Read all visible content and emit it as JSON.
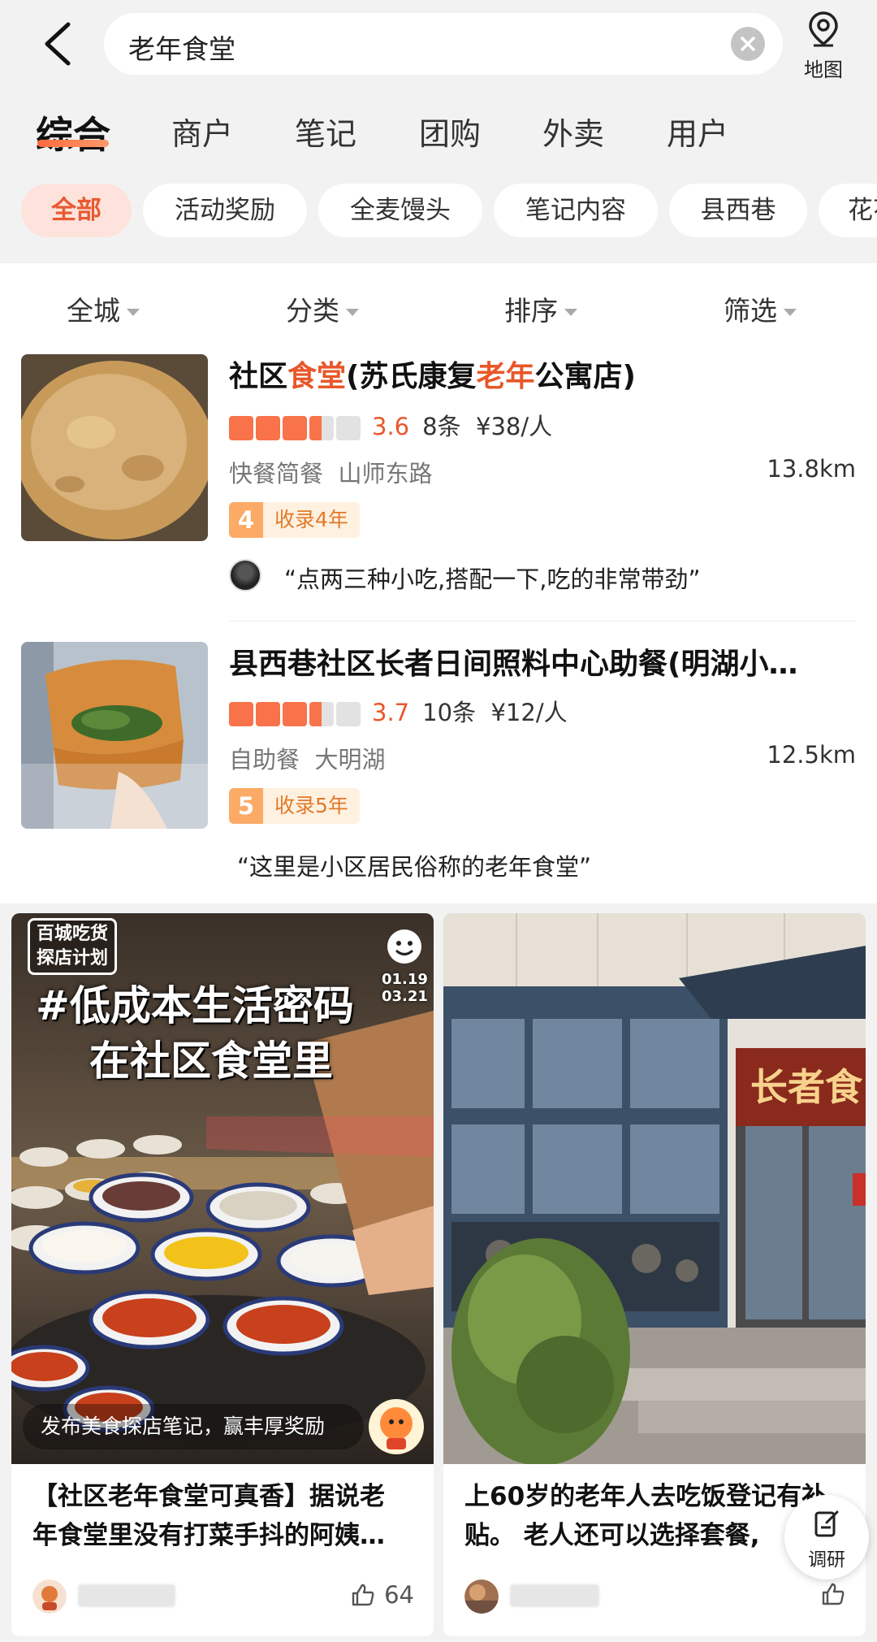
{
  "search": {
    "query": "老年食堂",
    "map_label": "地图"
  },
  "tabs": [
    {
      "label": "综合",
      "active": true
    },
    {
      "label": "商户"
    },
    {
      "label": "笔记"
    },
    {
      "label": "团购"
    },
    {
      "label": "外卖"
    },
    {
      "label": "用户"
    }
  ],
  "chips": [
    "全部",
    "活动奖励",
    "全麦馒头",
    "笔记内容",
    "县西巷",
    "花花"
  ],
  "filters": [
    "全城",
    "分类",
    "排序",
    "筛选"
  ],
  "listings": [
    {
      "title_parts": [
        "社区",
        "食堂",
        "(苏氏康复",
        "老年",
        "公寓店)"
      ],
      "rating": 3.6,
      "score_text": "3.6",
      "reviews": "8条",
      "price": "¥38/人",
      "category": "快餐简餐",
      "area": "山师东路",
      "distance": "13.8km",
      "badge_num": "4",
      "badge_text": "收录4年",
      "review": "“点两三种小吃,搭配一下,吃的非常带劲”"
    },
    {
      "title": "县西巷社区长者日间照料中心助餐(明湖小…",
      "rating": 3.7,
      "score_text": "3.7",
      "reviews": "10条",
      "price": "¥12/人",
      "category": "自助餐",
      "area": "大明湖",
      "distance": "12.5km",
      "badge_num": "5",
      "badge_text": "收录5年",
      "review": "“这里是小区居民俗称的老年食堂”"
    }
  ],
  "cards": [
    {
      "image_tag": [
        "百城吃货",
        "探店计划"
      ],
      "image_headline_1": "#低成本生活密码",
      "image_headline_2": "在社区食堂里",
      "image_date": [
        "01.19",
        "03.21"
      ],
      "image_caption": "发布美食探店笔记，赢丰厚奖励",
      "title_line1": "【社区老年食堂可真香】据说老",
      "title_line2": "年食堂里没有打菜手抖的阿姨…",
      "likes": "64"
    },
    {
      "sign_text": "长者食",
      "title_line1": "上60岁的老年人去吃饭登记有补",
      "title_line2": "贴。 老人还可以选择套餐,"
    }
  ],
  "research": {
    "label": "调研"
  },
  "colors": {
    "accent": "#e8572a",
    "star": "#f8734a",
    "badge": "#fbab66"
  }
}
